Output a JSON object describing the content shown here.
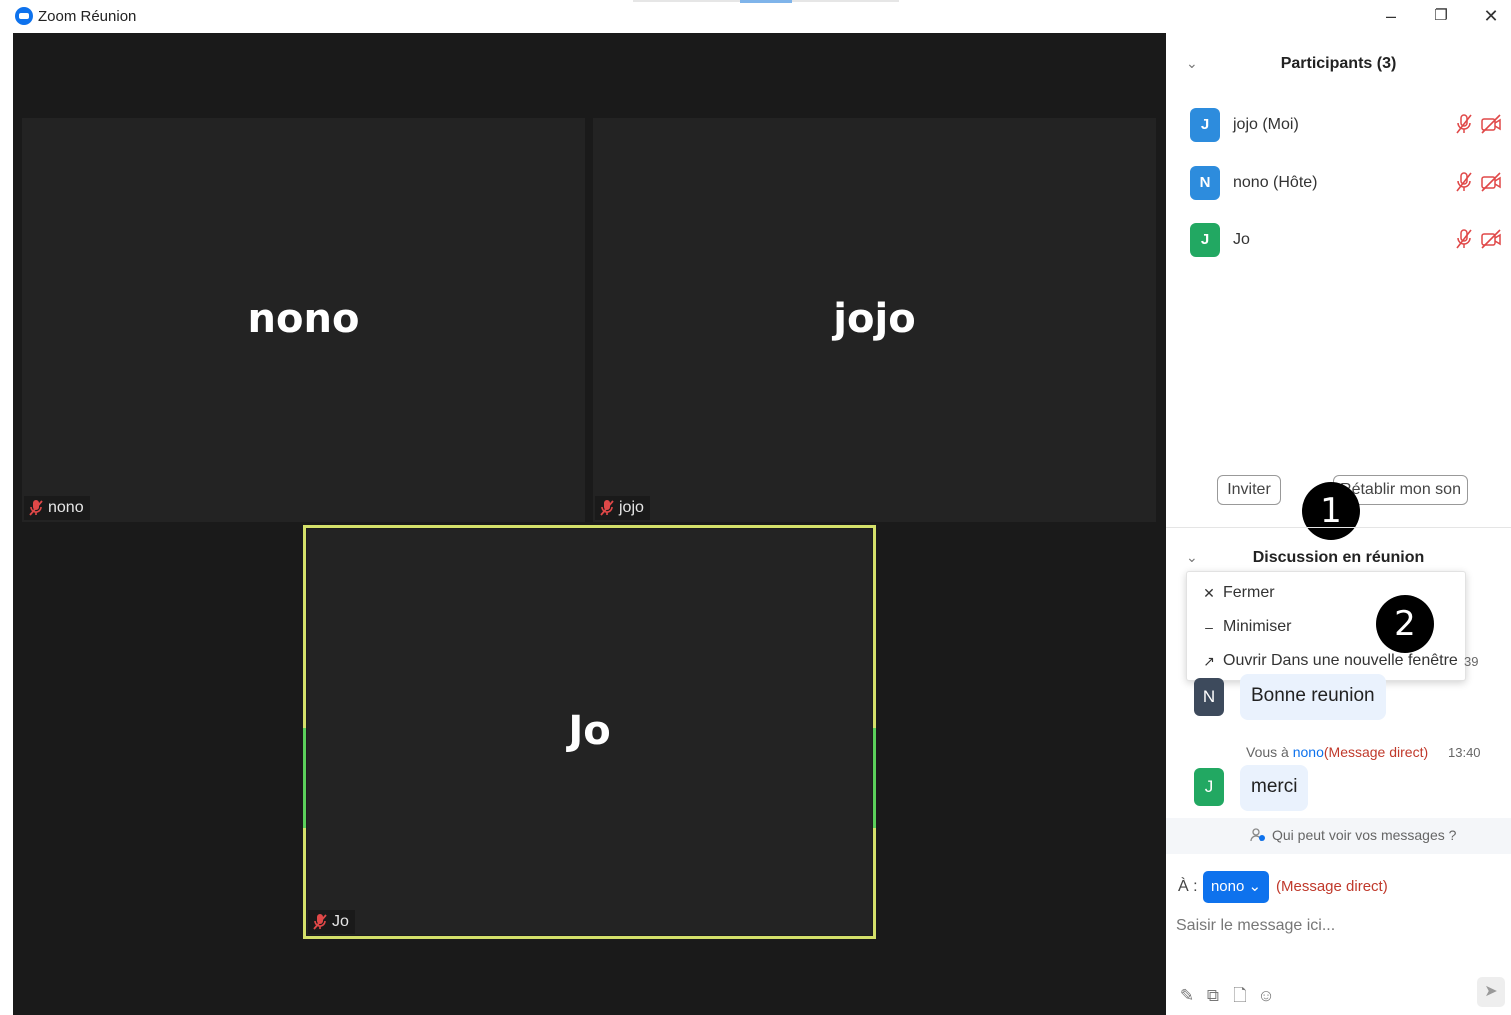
{
  "window": {
    "title": "Zoom Réunion",
    "minimize": "–",
    "restore": "❐",
    "close": "✕"
  },
  "video": {
    "tiles": [
      {
        "name": "nono",
        "label": "nono"
      },
      {
        "name": "jojo",
        "label": "jojo"
      },
      {
        "name": "Jo",
        "label": "Jo"
      }
    ]
  },
  "participants": {
    "title": "Participants (3)",
    "chevron": "⌄",
    "list": [
      {
        "initial": "J",
        "name": "jojo (Moi)",
        "color": "#2d8cdd"
      },
      {
        "initial": "N",
        "name": "nono (Hôte)",
        "color": "#2d8cdd"
      },
      {
        "initial": "J",
        "name": "Jo",
        "color": "#22a862"
      }
    ],
    "invite_button": "Inviter",
    "unmute_button": "Rétablir mon son",
    "step1": "1"
  },
  "chat": {
    "title": "Discussion en réunion",
    "chevron": "⌄",
    "menu": {
      "items": [
        {
          "icon": "✕",
          "label": "Fermer"
        },
        {
          "icon": "–",
          "label": "Minimiser"
        },
        {
          "icon": "↗",
          "label": "Ouvrir Dans une nouvelle fenêtre"
        }
      ]
    },
    "step2": "2",
    "partial_time": "39",
    "messages": [
      {
        "initial": "N",
        "text": "Bonne reunion",
        "avatar_color": "#3d4a5c"
      },
      {
        "initial": "J",
        "text": "merci",
        "avatar_color": "#22a862",
        "meta_prefix": "Vous à",
        "meta_to": "nono",
        "meta_dm": "(Message direct)",
        "time": "13:40"
      }
    ],
    "who_can_see": "Qui peut voir vos messages ?",
    "to_label": "À :",
    "recipient": "nono ⌄",
    "recipient_mode": "(Message direct)",
    "input_placeholder": "Saisir le message ici...",
    "tools": [
      "✎",
      "⧉",
      "🗋",
      "☺"
    ],
    "send": "➤"
  },
  "colors": {
    "accent": "#0e72ed",
    "active_speaker_border": "#d4e06a",
    "muted_red": "#e04848"
  }
}
